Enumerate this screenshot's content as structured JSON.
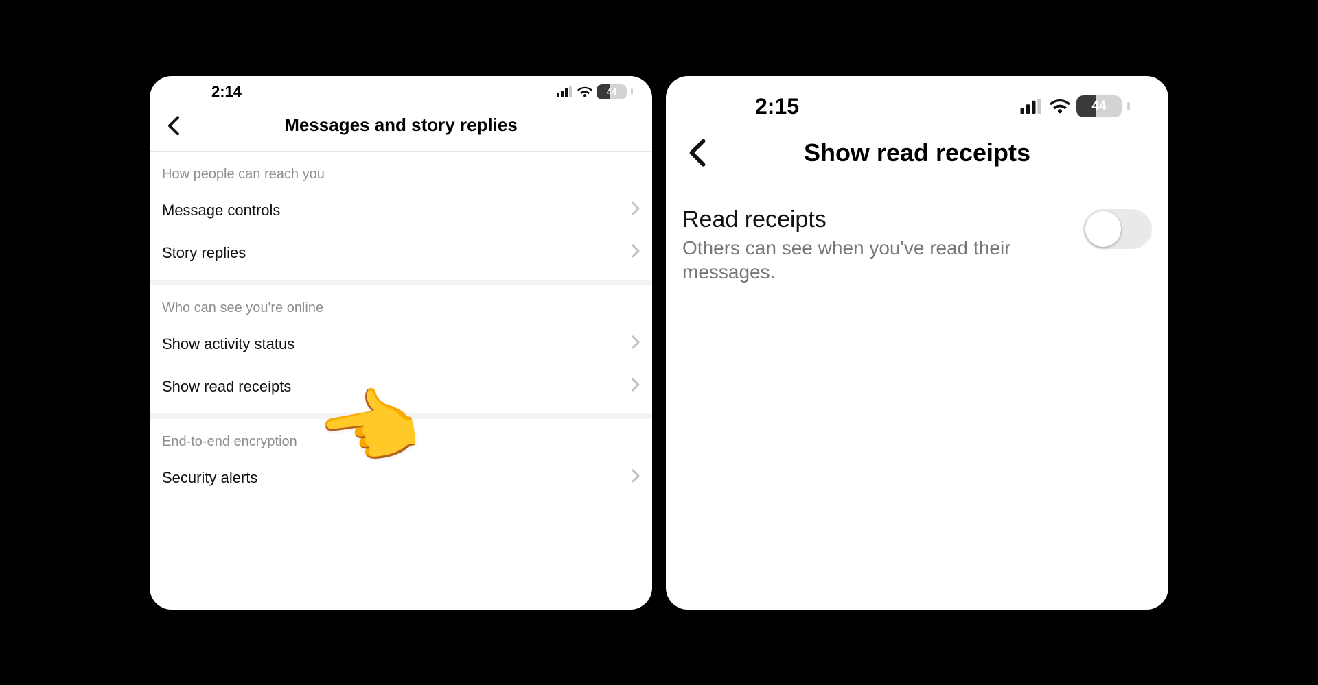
{
  "left": {
    "status": {
      "time": "2:14",
      "battery": "44",
      "battery_pct": 44
    },
    "nav_title": "Messages and story replies",
    "section1": {
      "header": "How people can reach you",
      "items": [
        "Message controls",
        "Story replies"
      ]
    },
    "section2": {
      "header": "Who can see you're online",
      "items": [
        "Show activity status",
        "Show read receipts"
      ]
    },
    "section3": {
      "header": "End-to-end encryption",
      "items": [
        "Security alerts"
      ]
    },
    "pointer_emoji": "👉"
  },
  "right": {
    "status": {
      "time": "2:15",
      "battery": "44",
      "battery_pct": 44
    },
    "nav_title": "Show read receipts",
    "toggle": {
      "title": "Read receipts",
      "subtitle": "Others can see when you've read their messages.",
      "on": false
    }
  }
}
